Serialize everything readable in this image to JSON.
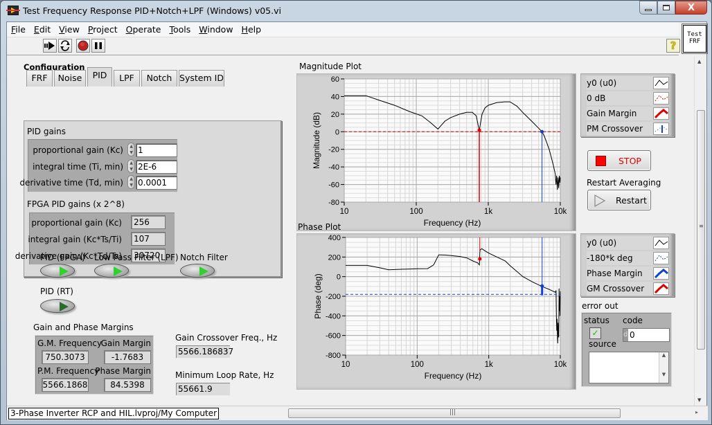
{
  "window": {
    "title": "Test Frequency Response PID+Notch+LPF (Windows) v05.vi",
    "close_glyph": "X"
  },
  "menu": {
    "items": [
      {
        "label": "File",
        "accel": "F",
        "rest": "ile"
      },
      {
        "label": "Edit",
        "accel": "E",
        "rest": "dit"
      },
      {
        "label": "View",
        "accel": "V",
        "rest": "iew"
      },
      {
        "label": "Project",
        "accel": "P",
        "rest": "roject"
      },
      {
        "label": "Operate",
        "accel": "O",
        "rest": "perate"
      },
      {
        "label": "Tools",
        "accel": "T",
        "rest": "ools"
      },
      {
        "label": "Window",
        "accel": "W",
        "rest": "indow"
      },
      {
        "label": "Help",
        "accel": "H",
        "rest": "elp"
      }
    ]
  },
  "toolbar": {
    "run_icon": "run-arrow-icon",
    "run_continuously_icon": "run-continuously-icon",
    "abort_icon": "abort-icon",
    "pause_icon": "pause-icon",
    "help_glyph": "?",
    "vi_icon_line1": "Test",
    "vi_icon_line2": "FRF"
  },
  "configuration": {
    "title": "Configuration",
    "tabs": [
      {
        "label": "FRF",
        "active": false
      },
      {
        "label": "Noise",
        "active": false
      },
      {
        "label": "PID",
        "active": true
      },
      {
        "label": "LPF",
        "active": false
      },
      {
        "label": "Notch",
        "active": false
      },
      {
        "label": "System ID",
        "active": false
      }
    ],
    "pid_gains": {
      "title": "PID gains",
      "proportional_label": "proportional gain (Kc)",
      "proportional_value": "1",
      "integral_label": "integral time (Ti, min)",
      "integral_value": "2E-6",
      "derivative_label": "derivative time (Td, min)",
      "derivative_value": "0.0001"
    },
    "fpga_gains": {
      "title": "FPGA PID gains (x 2^8)",
      "proportional_label": "proportional gain (Kc)",
      "proportional_value": "256",
      "integral_label": "integral gain (Kc*Ts/Ti)",
      "integral_value": "107",
      "derivative_label": "derivative gain (Kc*Td/Ts)",
      "derivative_value": "30720"
    }
  },
  "switches": {
    "pid_fpga": {
      "label": "PID (FPGA)",
      "on": true
    },
    "lpf": {
      "label": "Low Pass Filter (LPF)",
      "on": true
    },
    "notch": {
      "label": "Notch Filter",
      "on": true
    },
    "pid_rt": {
      "label": "PID (RT)",
      "on": false
    }
  },
  "margins": {
    "title": "Gain and Phase Margins",
    "gm_freq_label": "G.M. Frequency",
    "gm_freq_value": "750.3073",
    "gain_margin_label": "Gain Margin",
    "gain_margin_value": "-1.7683",
    "pm_freq_label": "P.M. Frequency",
    "pm_freq_value": "5566.1868",
    "phase_margin_label": "Phase Margin",
    "phase_margin_value": "84.5398"
  },
  "gain_crossover": {
    "label": "Gain Crossover Freq., Hz",
    "value": "5566.186837"
  },
  "min_loop_rate": {
    "label": "Minimum Loop Rate, Hz",
    "value": "55661.9"
  },
  "magnitude_legend": [
    {
      "label": "y0 (u0)",
      "color": "#000000",
      "style": "solid"
    },
    {
      "label": "0 dB",
      "color": "#e00000",
      "style": "dashed"
    },
    {
      "label": "Gain Margin",
      "color": "#e00000",
      "style": "thick"
    },
    {
      "label": "PM Crossover",
      "color": "#1040d0",
      "style": "points"
    }
  ],
  "phase_legend": [
    {
      "label": "y0 (u0)",
      "color": "#000000",
      "style": "solid"
    },
    {
      "label": "-180*k deg",
      "color": "#1040d0",
      "style": "dashed"
    },
    {
      "label": "Phase Margin",
      "color": "#1040d0",
      "style": "thick"
    },
    {
      "label": "GM Crossover",
      "color": "#e00000",
      "style": "thick"
    }
  ],
  "stop_button": {
    "label": "STOP",
    "color": "#e00000"
  },
  "restart": {
    "title": "Restart Averaging",
    "label": "Restart"
  },
  "error_out": {
    "title": "error out",
    "status_label": "status",
    "code_label": "code",
    "code_radix": "d",
    "code_value": "0",
    "source_label": "source",
    "source_value": "",
    "status_ok": true
  },
  "status_bar": {
    "context": "3-Phase Inverter RCP and HIL.lvproj/My Computer"
  },
  "chart_data": [
    {
      "type": "line",
      "title": "Magnitude Plot",
      "xlabel": "Frequency (Hz)",
      "ylabel": "Magnitude (dB)",
      "xscale": "log",
      "xlim": [
        10,
        10000
      ],
      "ylim": [
        -80,
        60
      ],
      "xticks": [
        {
          "v": 10,
          "label": "10"
        },
        {
          "v": 100,
          "label": "100"
        },
        {
          "v": 1000,
          "label": "1k"
        },
        {
          "v": 10000,
          "label": "10k"
        }
      ],
      "yticks": [
        60,
        40,
        20,
        0,
        -20,
        -40,
        -60,
        -80
      ],
      "grid": true,
      "series": [
        {
          "name": "y0 (u0)",
          "color": "#000000",
          "x": [
            10,
            20,
            30,
            50,
            80,
            120,
            160,
            200,
            250,
            300,
            400,
            500,
            600,
            680,
            720,
            750,
            780,
            820,
            900,
            1000,
            1300,
            1700,
            2000,
            2500,
            3000,
            4000,
            5000,
            5566,
            6000,
            7000,
            8000,
            8500,
            8700,
            8900,
            9100,
            9300,
            9500,
            9700,
            9900,
            10000
          ],
          "y": [
            41,
            41,
            36,
            30,
            23,
            18,
            10,
            3,
            12,
            16,
            20,
            22,
            22,
            18,
            8,
            1,
            10,
            20,
            27,
            30,
            33,
            34,
            34,
            29,
            22,
            12,
            4,
            0,
            -5,
            -20,
            -38,
            -48,
            -60,
            -50,
            -66,
            -52,
            -64,
            -50,
            -58,
            -52
          ]
        },
        {
          "name": "0 dB",
          "color": "#e00000",
          "dashed": true,
          "x": [
            10,
            10000
          ],
          "y": [
            0,
            0
          ]
        }
      ],
      "markers": [
        {
          "name": "Gain Margin",
          "color": "#e00000",
          "x": 750.3073,
          "y": 1.7683
        },
        {
          "name": "PM Crossover",
          "color": "#1040d0",
          "x": 5566.1868,
          "y": 0
        }
      ]
    },
    {
      "type": "line",
      "title": "Phase Plot",
      "xlabel": "Frequency (Hz)",
      "ylabel": "Phase (deg)",
      "xscale": "log",
      "xlim": [
        10,
        10000
      ],
      "ylim": [
        -800,
        400
      ],
      "xticks": [
        {
          "v": 10,
          "label": "10"
        },
        {
          "v": 100,
          "label": "100"
        },
        {
          "v": 1000,
          "label": "1k"
        },
        {
          "v": 10000,
          "label": "10k"
        }
      ],
      "yticks": [
        400,
        200,
        0,
        -200,
        -400,
        -600,
        -800
      ],
      "grid": true,
      "series": [
        {
          "name": "y0 (u0)",
          "color": "#000000",
          "x": [
            10,
            20,
            30,
            40,
            60,
            80,
            100,
            140,
            170,
            200,
            250,
            300,
            400,
            500,
            600,
            700,
            740,
            750,
            760,
            800,
            900,
            1000,
            1300,
            1700,
            2000,
            2500,
            3000,
            4000,
            5000,
            5566,
            6000,
            7000,
            8000,
            8500,
            8700,
            8800,
            8900,
            9000,
            9100,
            9200,
            9300,
            9400,
            9500,
            9600,
            9700,
            9800,
            9900,
            10000
          ],
          "y": [
            115,
            115,
            90,
            70,
            75,
            78,
            80,
            82,
            120,
            222,
            220,
            215,
            205,
            190,
            160,
            140,
            120,
            250,
            275,
            285,
            260,
            240,
            200,
            160,
            110,
            50,
            0,
            -50,
            -85,
            -100,
            -110,
            -130,
            -150,
            -160,
            -140,
            -400,
            -550,
            -430,
            -600,
            -680,
            -470,
            -580,
            -620,
            -120,
            -350,
            -200,
            -400,
            -150
          ]
        },
        {
          "name": "-180*k deg",
          "color": "#1040d0",
          "dashed": true,
          "x": [
            10,
            10000
          ],
          "y": [
            -180,
            -180
          ]
        }
      ],
      "markers": [
        {
          "name": "GM Crossover",
          "color": "#e00000",
          "x": 750.3073,
          "y": 180
        },
        {
          "name": "Phase Margin",
          "color": "#1040d0",
          "x": 5566.1868,
          "y": -95.46
        }
      ]
    }
  ]
}
